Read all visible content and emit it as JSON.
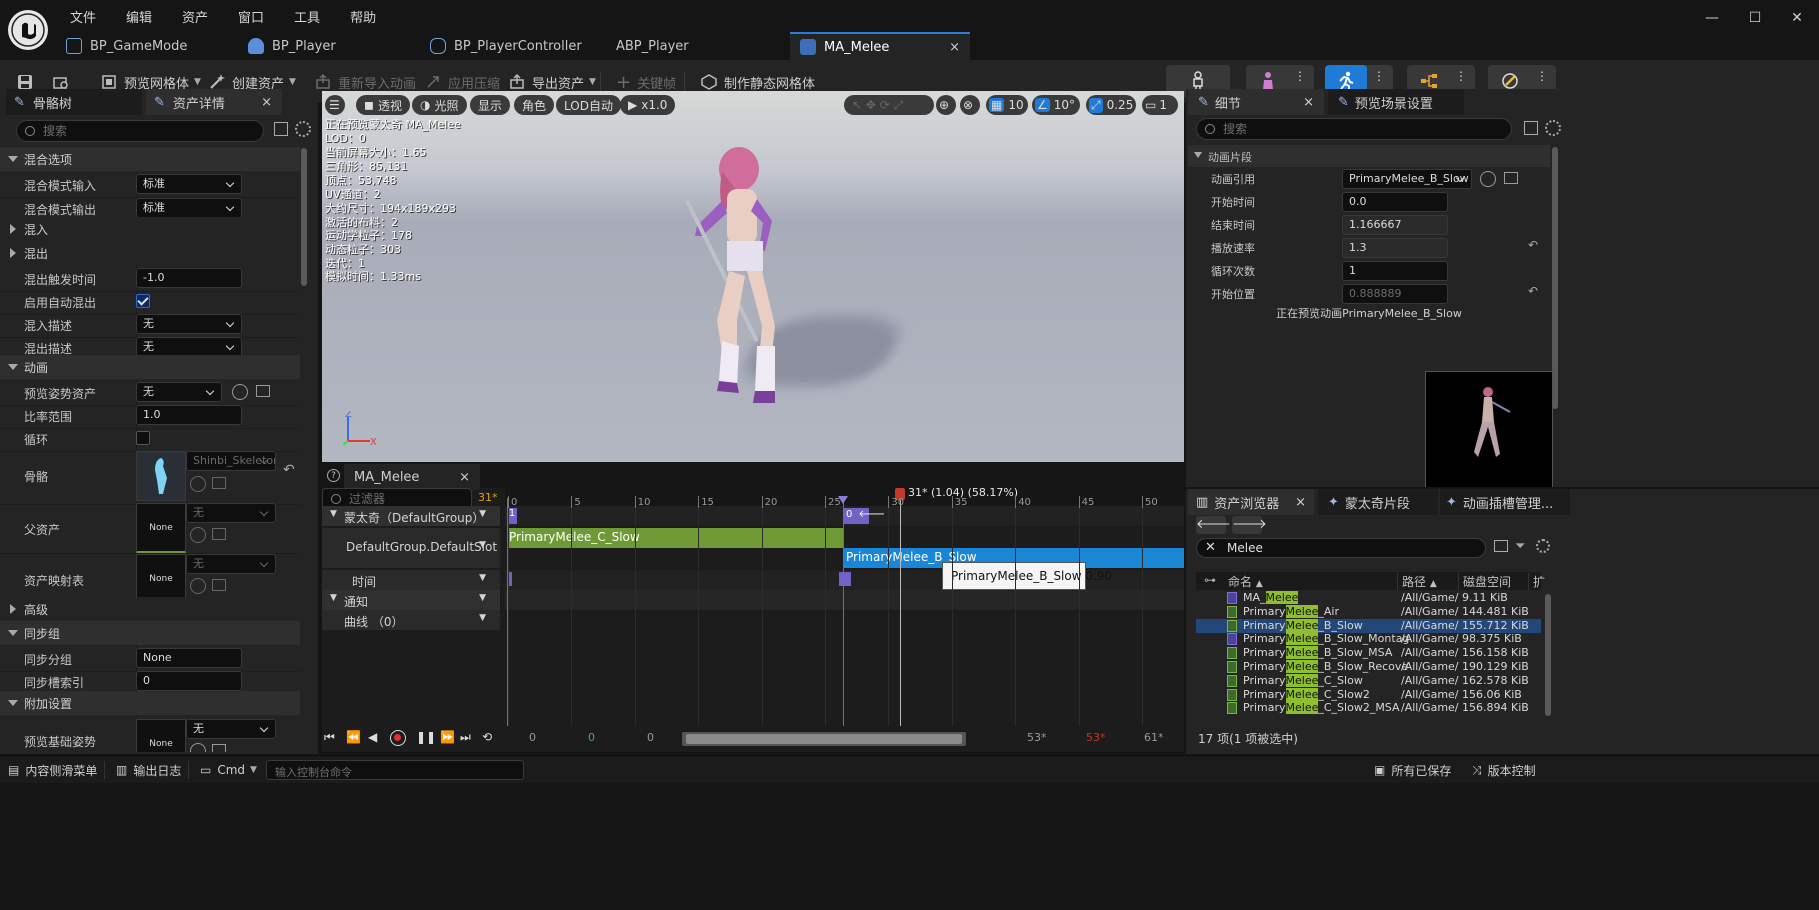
{
  "menu": [
    "文件",
    "编辑",
    "资产",
    "窗口",
    "工具",
    "帮助"
  ],
  "doc_tabs": [
    {
      "label": "BP_GameMode"
    },
    {
      "label": "BP_Player"
    },
    {
      "label": "BP_PlayerController"
    },
    {
      "label": "ABP_Player"
    },
    {
      "label": "MA_Melee",
      "active": true,
      "close": "×"
    }
  ],
  "toolbar": {
    "preview_mesh": "预览网格体",
    "create_asset": "创建资产",
    "reimport": "重新导入动画",
    "apply_compress": "应用压缩",
    "export_asset": "导出资产",
    "key": "关键帧",
    "make_static": "制作静态网格体"
  },
  "left": {
    "tab_skeleton": "骨骼树",
    "tab_details": "资产详情",
    "close": "×",
    "search_placeholder": "搜索",
    "sections": {
      "blend_options": "混合选项",
      "blend_in": "混入",
      "blend_out": "混出",
      "animation": "动画",
      "advanced": "高级",
      "sync_group": "同步组",
      "additive": "附加设置"
    },
    "rows": {
      "blend_mode_in": {
        "label": "混合模式输入",
        "value": "标准"
      },
      "blend_mode_out": {
        "label": "混合模式输出",
        "value": "标准"
      },
      "blend_out_trigger": {
        "label": "混出触发时间",
        "value": "-1.0"
      },
      "auto_blend_out": {
        "label": "启用自动混出"
      },
      "blend_in_desc": {
        "label": "混入描述",
        "value": "无"
      },
      "blend_out_desc": {
        "label": "混出描述",
        "value": "无"
      },
      "preview_pose": {
        "label": "预览姿势资产",
        "value": "无"
      },
      "rate_scale": {
        "label": "比率范围",
        "value": "1.0"
      },
      "loop": {
        "label": "循环"
      },
      "skeleton": {
        "label": "骨骼",
        "value": "Shinbi_Skeleton"
      },
      "parent_asset": {
        "label": "父资产",
        "thumb": "None",
        "value": "无"
      },
      "asset_mapping": {
        "label": "资产映射表",
        "thumb": "None",
        "value": "无"
      },
      "sync_group_name": {
        "label": "同步分组",
        "value": "None"
      },
      "sync_slot_index": {
        "label": "同步槽索引",
        "value": "0"
      },
      "preview_base_pose": {
        "label": "预览基础姿势",
        "thumb": "None",
        "value": "无"
      }
    }
  },
  "viewport": {
    "pills": [
      "透视",
      "光照",
      "显示",
      "角色",
      "LOD自动",
      "x1.0"
    ],
    "grid": "10",
    "angle": "10°",
    "scale": "0.25",
    "cam": "1",
    "stats": [
      "正在预览蒙太奇 MA_Melee",
      "LOD：0",
      "当前屏幕大小：1.65",
      "三角形：85,131",
      "顶点：53,748",
      "UV通道：2",
      "大约尺寸：194x189x293",
      "激活的布料：2",
      "运动学粒子：178",
      "动态粒子：303",
      "迭代：1",
      "模拟时间：1.33ms"
    ]
  },
  "timeline": {
    "tab": "MA_Melee",
    "close": "×",
    "filter_placeholder": "过滤器",
    "frame": "31*",
    "tracks": {
      "montage": "蒙太奇（DefaultGroup）",
      "slot": "DefaultGroup.DefaultSlot",
      "time": "时间",
      "notify": "通知",
      "curves": "曲线 （0）"
    },
    "ruler": [
      "0",
      "5",
      "10",
      "15",
      "20",
      "25",
      "30",
      "35",
      "40",
      "45",
      "50"
    ],
    "playhead_label": "31* (1.04) (58.17%)",
    "section_markers": [
      "1",
      "0"
    ],
    "segments": [
      "PrimaryMelee_C_Slow",
      "PrimaryMelee_B_Slow"
    ],
    "tooltip": "PrimaryMelee_B_Slow 0.90",
    "bottom": {
      "start": "0",
      "a": "0",
      "b": "0",
      "end1": "53*",
      "end2": "53*",
      "end3": "61*"
    }
  },
  "details": {
    "tab": "细节",
    "close": "×",
    "tab2": "预览场景设置",
    "search_placeholder": "搜索",
    "section": "动画片段",
    "rows": [
      {
        "label": "动画引用",
        "value": "PrimaryMelee_B_Slow"
      },
      {
        "label": "开始时间",
        "value": "0.0"
      },
      {
        "label": "结束时间",
        "value": "1.166667"
      },
      {
        "label": "播放速率",
        "value": "1.3"
      },
      {
        "label": "循环次数",
        "value": "1"
      },
      {
        "label": "开始位置",
        "value": "0.888889"
      }
    ],
    "preview_caption": "正在预览动画PrimaryMelee_B_Slow"
  },
  "content_browser": {
    "tab": "资产浏览器",
    "close": "×",
    "tab2": "蒙太奇片段",
    "tab3": "动画插槽管理...",
    "search_value": "Melee",
    "columns": [
      "命名",
      "路径",
      "磁盘空间",
      "扩"
    ],
    "items": [
      {
        "pre": "MA_",
        "hl": "Melee",
        "post": "",
        "path": "/All/Game/",
        "size": "9.11 KiB"
      },
      {
        "pre": "Primary",
        "hl": "Melee",
        "post": "_Air",
        "path": "/All/Game/",
        "size": "144.481 KiB"
      },
      {
        "pre": "Primary",
        "hl": "Melee",
        "post": "_B_Slow",
        "path": "/All/Game/",
        "size": "155.712 KiB",
        "selected": true
      },
      {
        "pre": "Primary",
        "hl": "Melee",
        "post": "_B_Slow_Montag",
        "path": "/All/Game/",
        "size": "98.375 KiB"
      },
      {
        "pre": "Primary",
        "hl": "Melee",
        "post": "_B_Slow_MSA",
        "path": "/All/Game/",
        "size": "156.158 KiB"
      },
      {
        "pre": "Primary",
        "hl": "Melee",
        "post": "_B_Slow_Recove",
        "path": "/All/Game/",
        "size": "190.129 KiB"
      },
      {
        "pre": "Primary",
        "hl": "Melee",
        "post": "_C_Slow",
        "path": "/All/Game/",
        "size": "162.578 KiB"
      },
      {
        "pre": "Primary",
        "hl": "Melee",
        "post": "_C_Slow2",
        "path": "/All/Game/",
        "size": "156.06 KiB"
      },
      {
        "pre": "Primary",
        "hl": "Melee",
        "post": "_C_Slow2_MSA",
        "path": "/All/Game/",
        "size": "156.894 KiB"
      }
    ],
    "status": "17 项(1 项被选中)"
  },
  "statusbar": {
    "content_drawer": "内容侧滑菜单",
    "output_log": "输出日志",
    "cmd": "Cmd",
    "console_placeholder": "输入控制台命令",
    "save_all": "所有已保存",
    "source_control": "版本控制"
  },
  "colors": {
    "accent": "#2a7bd8",
    "green_segment": "#6d9a34",
    "blue_segment": "#1a86d6",
    "highlight": "#8fbf2f"
  }
}
